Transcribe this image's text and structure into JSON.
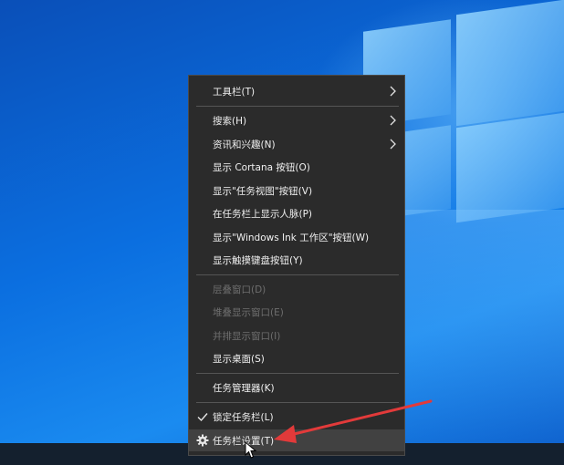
{
  "menu": {
    "items": [
      {
        "label": "工具栏(T)",
        "submenu": true,
        "disabled": false
      },
      {
        "label": "搜索(H)",
        "submenu": true,
        "disabled": false
      },
      {
        "label": "资讯和兴趣(N)",
        "submenu": true,
        "disabled": false
      },
      {
        "label": "显示 Cortana 按钮(O)",
        "submenu": false,
        "disabled": false
      },
      {
        "label": "显示\"任务视图\"按钮(V)",
        "submenu": false,
        "disabled": false
      },
      {
        "label": "在任务栏上显示人脉(P)",
        "submenu": false,
        "disabled": false
      },
      {
        "label": "显示\"Windows Ink 工作区\"按钮(W)",
        "submenu": false,
        "disabled": false
      },
      {
        "label": "显示触摸键盘按钮(Y)",
        "submenu": false,
        "disabled": false
      },
      {
        "label": "层叠窗口(D)",
        "submenu": false,
        "disabled": true
      },
      {
        "label": "堆叠显示窗口(E)",
        "submenu": false,
        "disabled": true
      },
      {
        "label": "并排显示窗口(I)",
        "submenu": false,
        "disabled": true
      },
      {
        "label": "显示桌面(S)",
        "submenu": false,
        "disabled": false
      },
      {
        "label": "任务管理器(K)",
        "submenu": false,
        "disabled": false
      },
      {
        "label": "锁定任务栏(L)",
        "submenu": false,
        "disabled": false,
        "checked": true
      },
      {
        "label": "任务栏设置(T)",
        "submenu": false,
        "disabled": false,
        "icon": "gear-icon",
        "highlighted": true
      }
    ]
  },
  "colors": {
    "menu_bg": "#2b2b2b",
    "hover_bg": "#414141",
    "text": "#f0f0f0",
    "disabled_text": "#6e6e6e",
    "annotation": "#e23a3a"
  }
}
